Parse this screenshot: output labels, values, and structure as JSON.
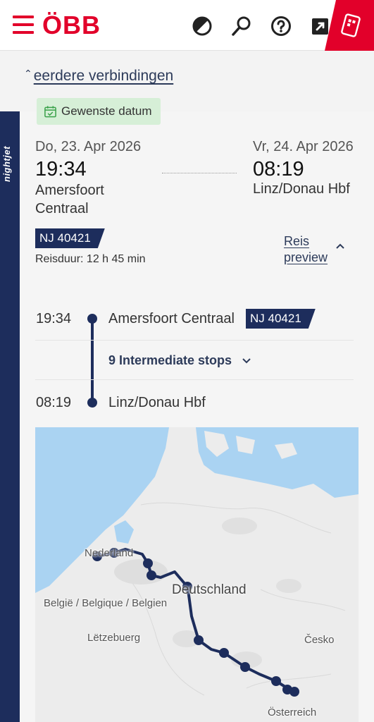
{
  "header": {
    "logo": "ÖBB",
    "icons": [
      "menu-icon",
      "contrast-icon",
      "search-icon",
      "help-icon",
      "external-link-icon",
      "ticket-icon"
    ]
  },
  "earlier": {
    "label": "eerdere verbindingen"
  },
  "brand_strip": {
    "label": "nightjet"
  },
  "date_badge": {
    "label": "Gewenste datum"
  },
  "trip": {
    "departure": {
      "date": "Do, 23. Apr 2026",
      "time": "19:34",
      "station": "Amersfoort Centraal"
    },
    "arrival": {
      "date": "Vr, 24. Apr 2026",
      "time": "08:19",
      "station": "Linz/Donau Hbf"
    },
    "train": "NJ 40421",
    "duration": "Reisduur: 12 h 45 min",
    "preview_label": "Reis preview"
  },
  "timeline": {
    "start_time": "19:34",
    "start_station": "Amersfoort Centraal",
    "train": "NJ 40421",
    "stops_label": "9 Intermediate stops",
    "end_time": "08:19",
    "end_station": "Linz/Donau Hbf"
  },
  "map": {
    "labels": {
      "netherlands": "Nederland",
      "belgium": "België / Belgique / Belgien",
      "luxembourg": "Lëtzebuerg",
      "germany": "Deutschland",
      "czechia": "Česko",
      "austria": "Österreich"
    }
  },
  "colors": {
    "brand_red": "#e2002a",
    "nightjet_navy": "#1d2d5c",
    "date_badge_bg": "#d6efd7",
    "water": "#aad3f2"
  }
}
